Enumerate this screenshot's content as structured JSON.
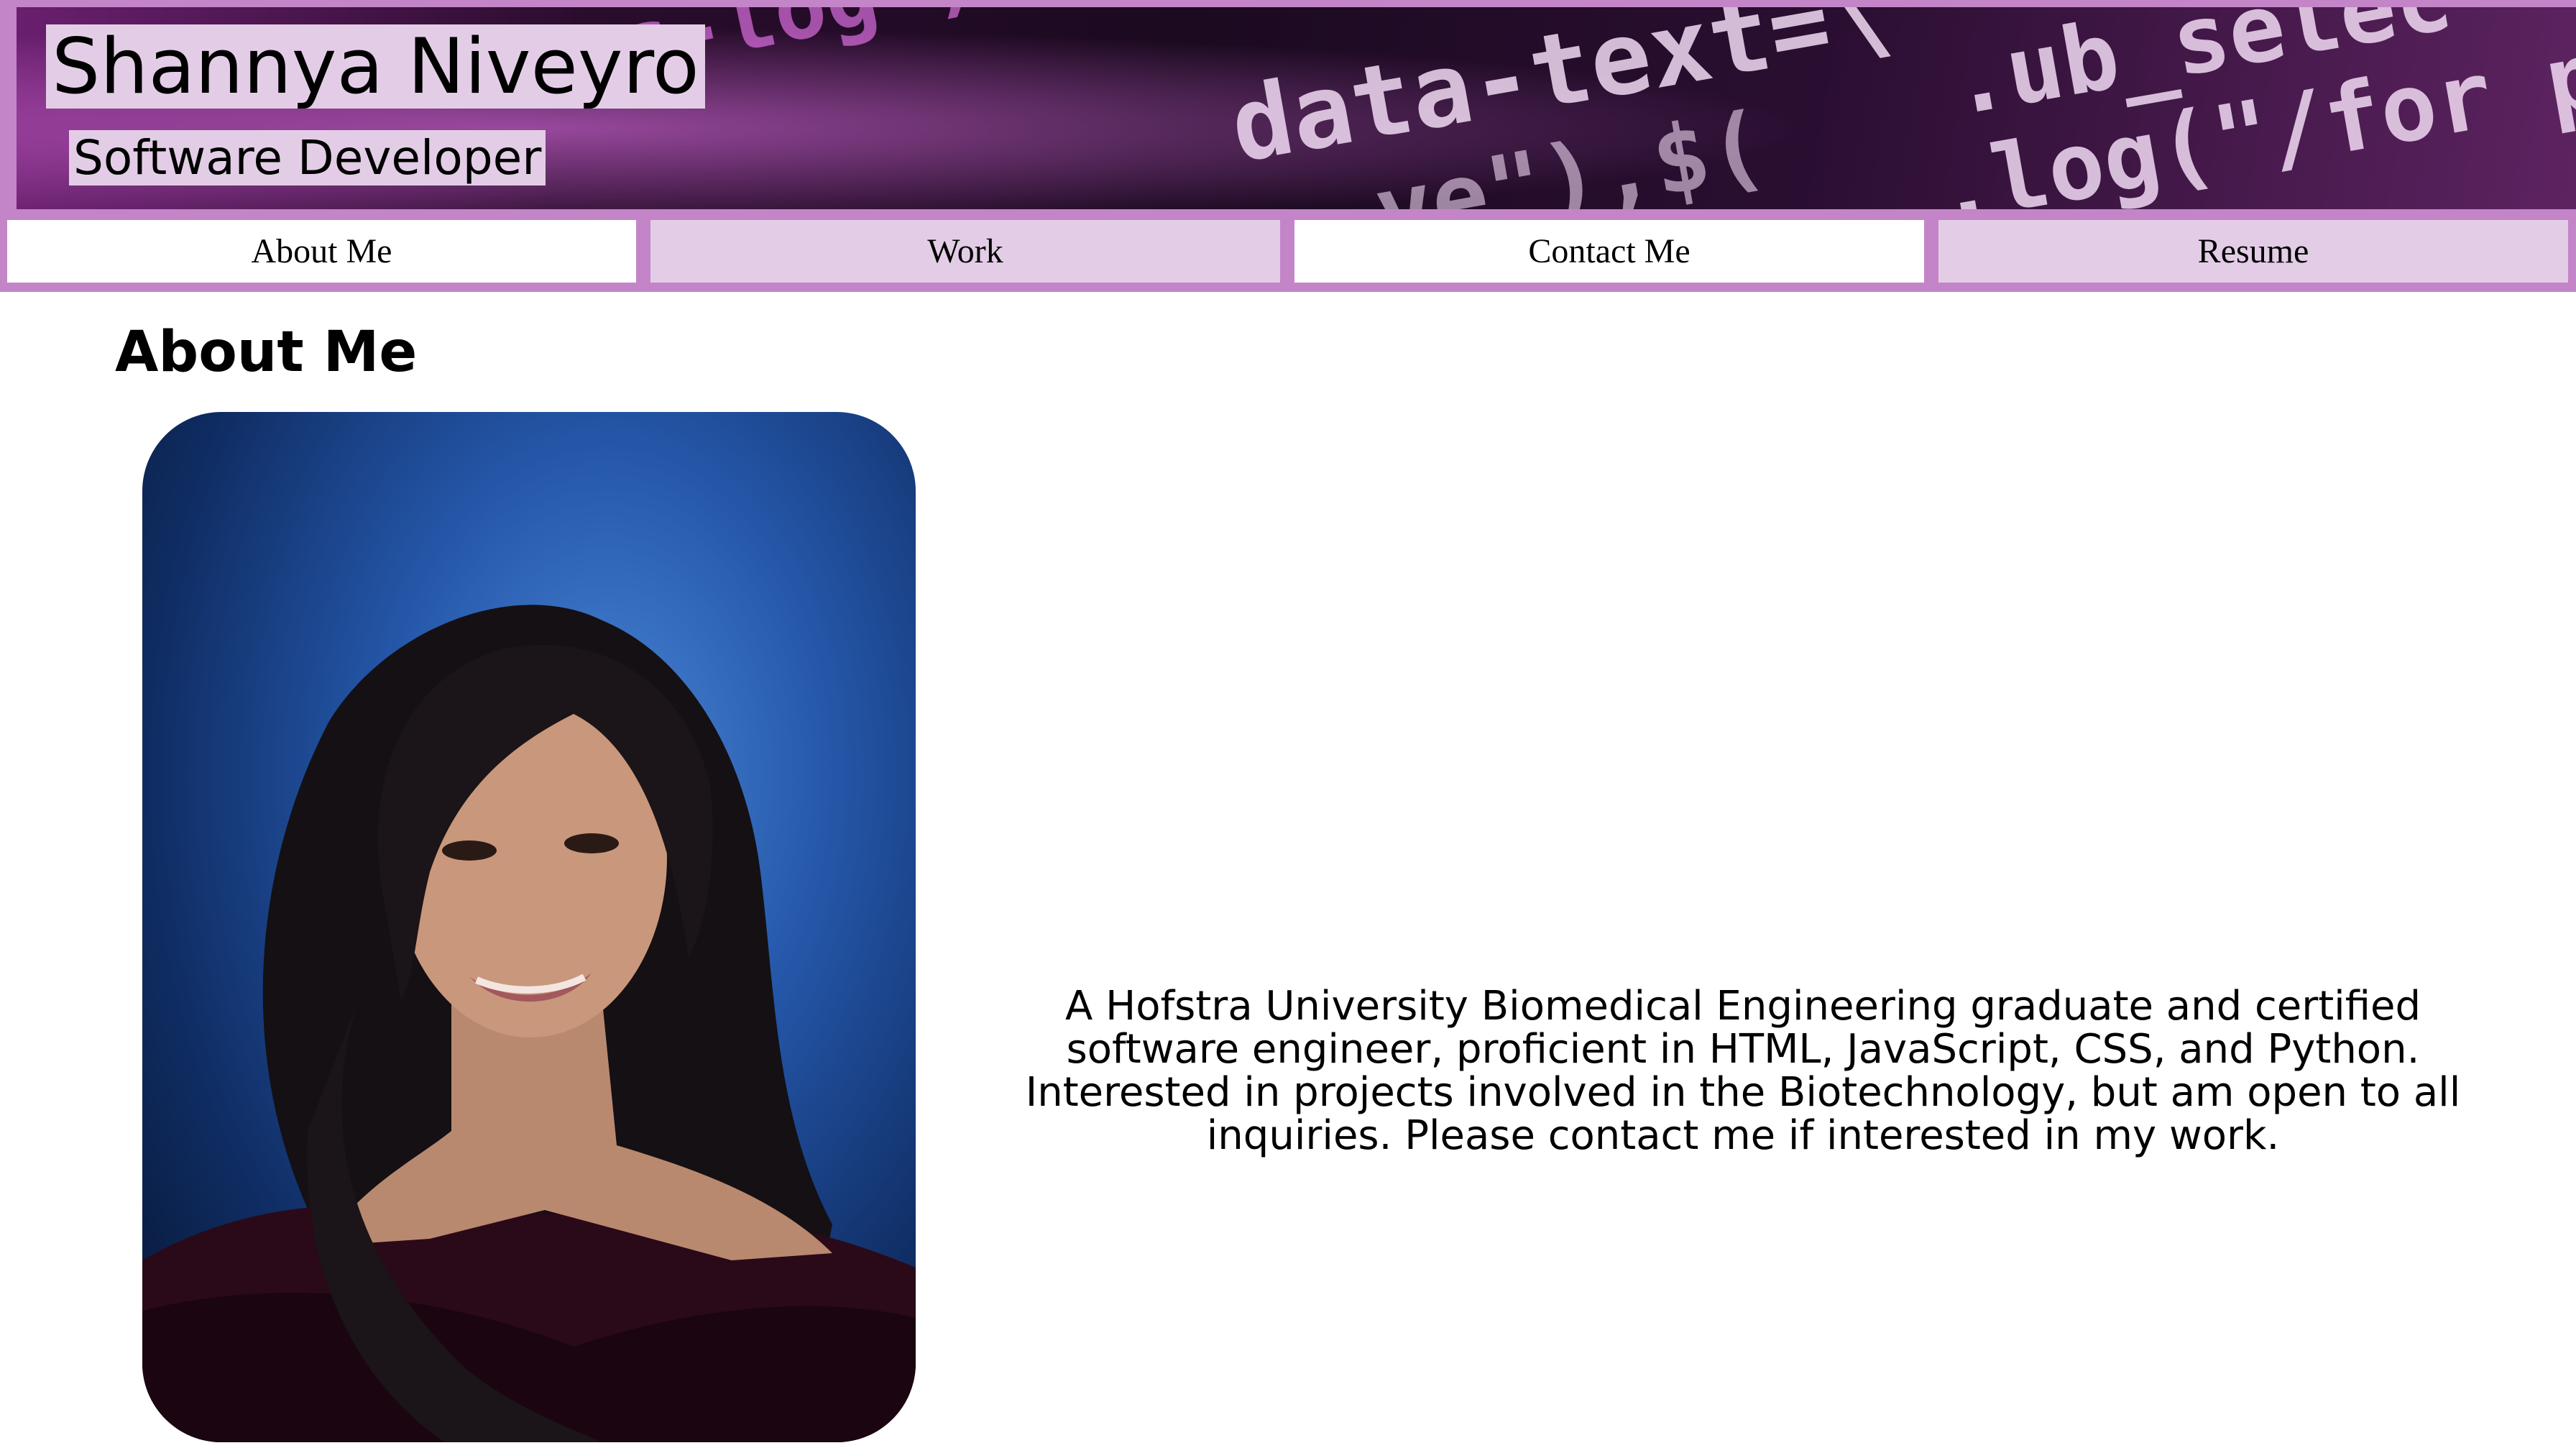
{
  "header": {
    "name": "Shannya Niveyro",
    "role": "Software Developer",
    "banner_code_text": [
      "ss-log\").hu",
      "data-text=\\",
      ".ub_selec",
      "$(\".ub_select",
      "ve\"),$(",
      ".log(\"/for p"
    ]
  },
  "nav": {
    "items": [
      {
        "label": "About Me"
      },
      {
        "label": "Work"
      },
      {
        "label": "Contact Me"
      },
      {
        "label": "Resume"
      }
    ]
  },
  "main": {
    "section_title": "About Me",
    "bio": "A Hofstra University Biomedical Engineering graduate and certified software engineer, proficient in HTML, JavaScript, CSS, and Python. Interested in projects involved in the Biotechnology, but am open to all inquiries. Please contact me if interested in my work."
  },
  "colors": {
    "accent": "#c385c8",
    "tint": "#e3cde6",
    "background": "#ffffff"
  }
}
